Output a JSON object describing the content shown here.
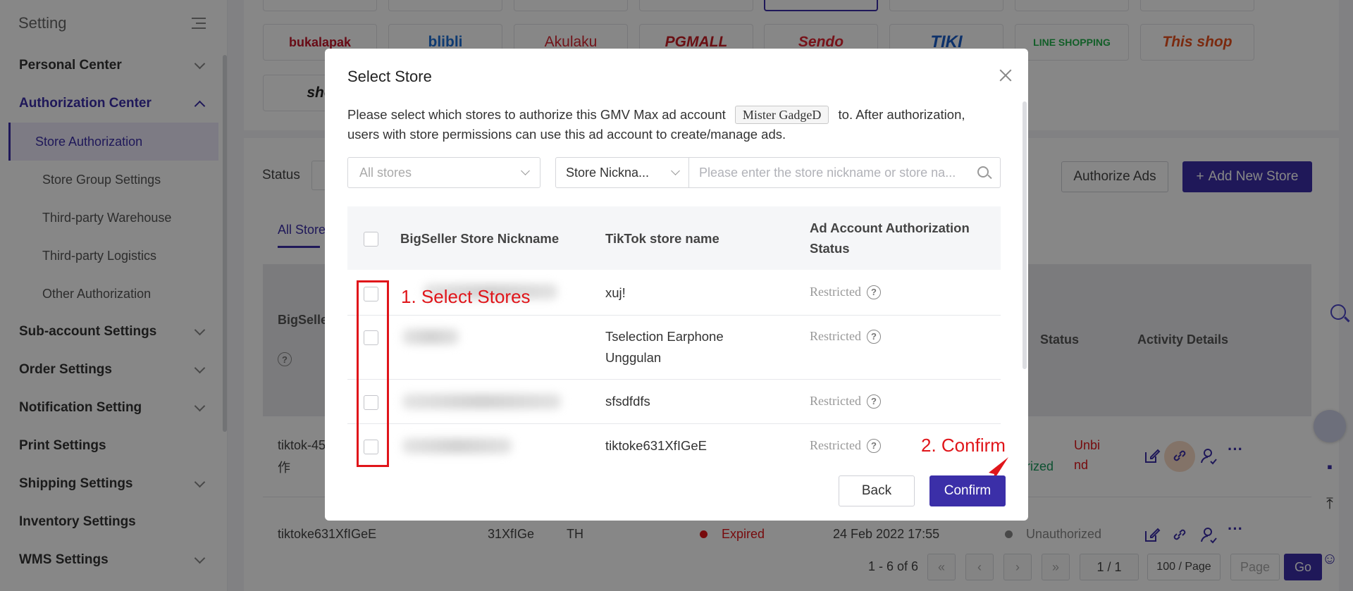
{
  "sidebar": {
    "title": "Setting",
    "menu": [
      {
        "label": "Personal Center"
      },
      {
        "label": "Authorization Center"
      },
      {
        "label": "Sub-account Settings"
      },
      {
        "label": "Order Settings"
      },
      {
        "label": "Notification Setting"
      },
      {
        "label": "Print Settings"
      },
      {
        "label": "Shipping Settings"
      },
      {
        "label": "Inventory Settings"
      },
      {
        "label": "WMS Settings"
      }
    ],
    "submenu": [
      {
        "label": "Store Authorization"
      },
      {
        "label": "Store Group Settings"
      },
      {
        "label": "Third-party Warehouse"
      },
      {
        "label": "Third-party Logistics"
      },
      {
        "label": "Other Authorization"
      }
    ]
  },
  "platforms": [
    "bukalapak",
    "blibli",
    "Akulaku",
    "PGMALL",
    "Sendo",
    "TIKI",
    "LINE SHOPPING",
    "This shop",
    "sho"
  ],
  "background": {
    "status_label": "Status",
    "authorize_ads": "Authorize Ads",
    "add_new_store": "Add New Store",
    "tab_all": "All Store",
    "col_nickname": "BigSeller",
    "col_status": "Status",
    "col_activity": "Activity Details",
    "row1": {
      "name": "tiktok-45",
      "name2": "作",
      "auth": "orized",
      "unbind1": "Unbi",
      "unbind2": "nd"
    },
    "row2": {
      "name": "tiktoke631XfIGeE",
      "short": "31XfIGe",
      "country": "TH",
      "state": "Expired",
      "date": "24 Feb 2022 17:55",
      "status": "Unauthorized"
    },
    "pager": {
      "summary": "1 - 6 of 6",
      "page": "1 / 1",
      "per_page": "100 / Page",
      "goto_placeholder": "Page",
      "go": "Go"
    }
  },
  "modal": {
    "title": "Select Store",
    "desc_before": "Please select which stores to authorize this GMV Max ad account",
    "account": "Mister GadgeD",
    "desc_after": "to. After authorization, users with store permissions can use this ad account to create/manage ads.",
    "stores_placeholder": "All stores",
    "search_type": "Store Nickna...",
    "search_placeholder": "Please enter the store nickname or store na...",
    "col_nickname": "BigSeller Store Nickname",
    "col_tiktok": "TikTok store name",
    "col_status": "Ad Account Authorization Status",
    "rows": [
      {
        "tiktok": "xuj!",
        "status": "Restricted"
      },
      {
        "tiktok": "Tselection Earphone Unggulan",
        "status": "Restricted"
      },
      {
        "tiktok": "sfsdfdfs",
        "status": "Restricted"
      },
      {
        "tiktok": "tiktoke631XfIGeE",
        "status": "Restricted"
      }
    ],
    "back": "Back",
    "confirm": "Confirm"
  },
  "annotations": {
    "select": "1. Select Stores",
    "confirm": "2. Confirm"
  }
}
